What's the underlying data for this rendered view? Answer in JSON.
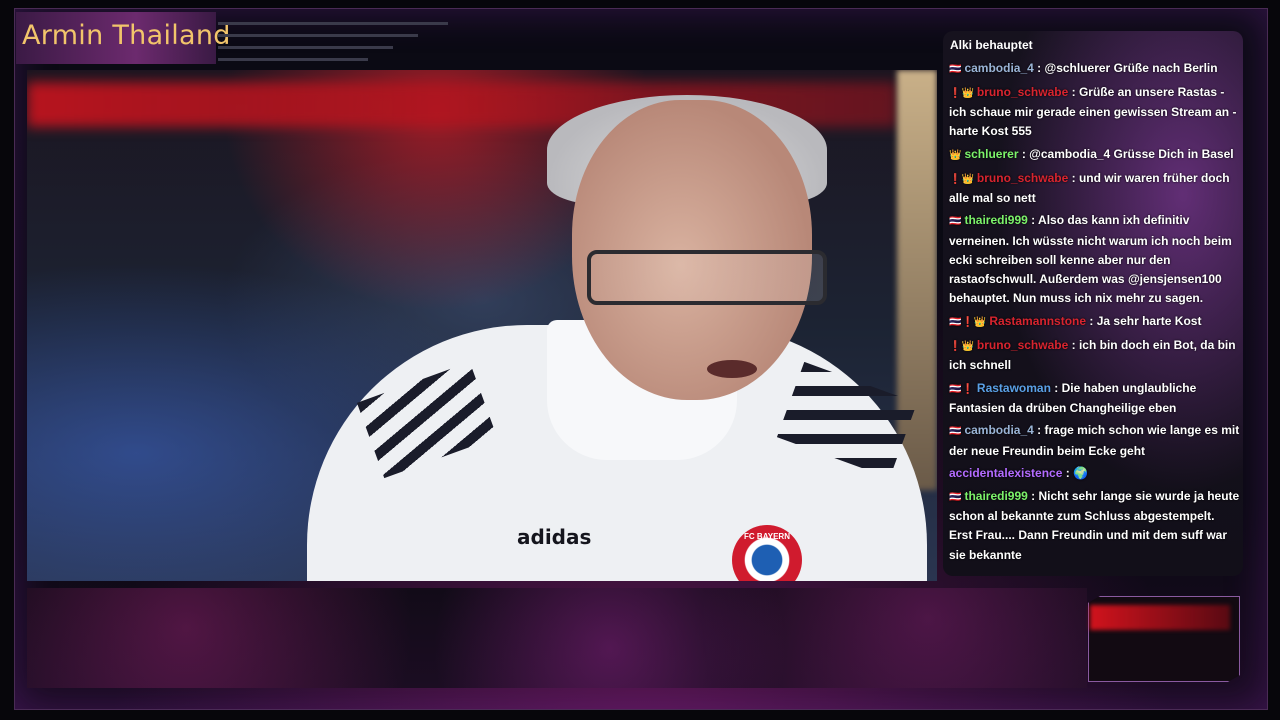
{
  "stream": {
    "title": "Armin Thailand"
  },
  "video": {
    "shirt_brand": "adidas",
    "crest_text": "FC BAYERN"
  },
  "chat": {
    "header": "Alki behauptet",
    "messages": [
      {
        "icons": "🇹🇭",
        "user": "cambodia_4",
        "color": "#9ab4d6",
        "text": "@schluerer Grüße nach Berlin"
      },
      {
        "icons": "❗👑",
        "user": "bruno_schwabe",
        "color": "#d8242f",
        "text": "Grüße an unsere Rastas - ich schaue mir gerade einen gewissen Stream an - harte Kost 555"
      },
      {
        "icons": "👑",
        "user": "schluerer",
        "color": "#7cf26a",
        "text": "@cambodia_4 Grüsse Dich in Basel"
      },
      {
        "icons": "❗👑",
        "user": "bruno_schwabe",
        "color": "#d8242f",
        "text": "und wir waren früher doch alle mal so nett"
      },
      {
        "icons": "🇹🇭",
        "user": "thairedi999",
        "color": "#7cf26a",
        "text": "Also das kann ixh definitiv verneinen. Ich wüsste nicht warum ich noch beim ecki schreiben soll kenne aber nur den rastaofschwull. Außerdem was @jensjensen100 behauptet. Nun muss ich nix mehr zu sagen."
      },
      {
        "icons": "🇹🇭❗👑",
        "user": "Rastamannstone",
        "color": "#d8242f",
        "text": "Ja sehr harte Kost"
      },
      {
        "icons": "❗👑",
        "user": "bruno_schwabe",
        "color": "#d8242f",
        "text": "ich bin doch ein Bot, da bin ich schnell"
      },
      {
        "icons": "🇹🇭❗",
        "user": "Rastawoman",
        "color": "#5aa0e6",
        "text": "Die haben unglaubliche Fantasien da drüben Changheilige eben"
      },
      {
        "icons": "🇹🇭",
        "user": "cambodia_4",
        "color": "#9ab4d6",
        "text": "frage mich schon wie lange es mit der neue Freundin beim Ecke geht"
      },
      {
        "icons": "",
        "user": "accidentalexistence",
        "color": "#b36bff",
        "text": "🌍"
      },
      {
        "icons": "🇹🇭",
        "user": "thairedi999",
        "color": "#7cf26a",
        "text": "Nicht sehr lange sie wurde ja heute schon al bekannte zum Schluss abgestempelt. Erst Frau.... Dann Freundin und mit dem suff war sie bekannte"
      }
    ]
  }
}
